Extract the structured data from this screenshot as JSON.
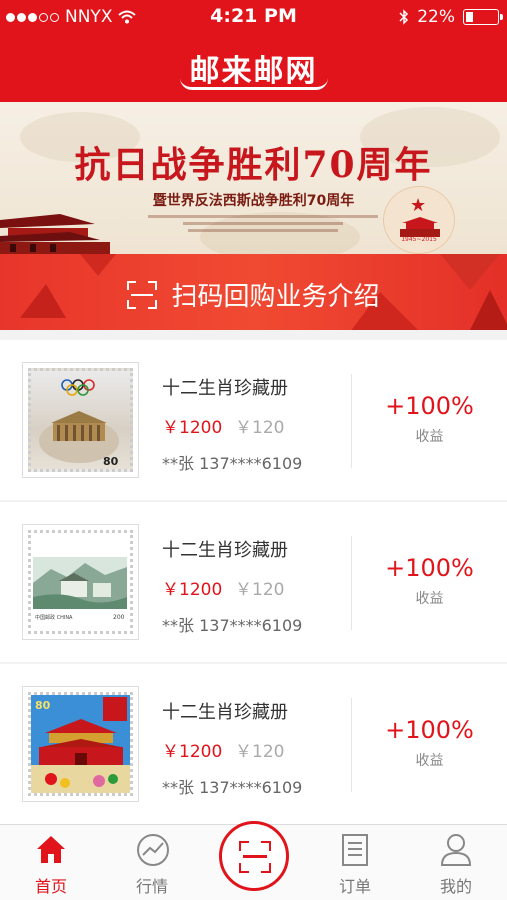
{
  "status_bar": {
    "carrier": "NNYX",
    "time": "4:21 PM",
    "battery": "22%",
    "battery_level": 0.22
  },
  "header": {
    "title": "邮来邮网"
  },
  "banner": {
    "title": "抗日战争胜利70周年",
    "subtitle": "暨世界反法西斯战争胜利70周年",
    "years": "1945~2015"
  },
  "scan_intro": {
    "label": "扫码回购业务介绍"
  },
  "items": [
    {
      "name": "十二生肖珍藏册",
      "price": "￥1200",
      "old_price": "￥120",
      "user": "**张 137****6109",
      "percent": "+100%",
      "gain_label": "收益"
    },
    {
      "name": "十二生肖珍藏册",
      "price": "￥1200",
      "old_price": "￥120",
      "user": "**张 137****6109",
      "percent": "+100%",
      "gain_label": "收益"
    },
    {
      "name": "十二生肖珍藏册",
      "price": "￥1200",
      "old_price": "￥120",
      "user": "**张 137****6109",
      "percent": "+100%",
      "gain_label": "收益"
    }
  ],
  "tabs": [
    {
      "label": "首页",
      "icon": "home-icon",
      "active": true
    },
    {
      "label": "行情",
      "icon": "chart-icon",
      "active": false
    },
    {
      "label": "",
      "icon": "scan-icon",
      "active": false
    },
    {
      "label": "订单",
      "icon": "order-icon",
      "active": false
    },
    {
      "label": "我的",
      "icon": "user-icon",
      "active": false
    }
  ],
  "colors": {
    "brand": "#e0141a",
    "accent": "#f04a32"
  }
}
